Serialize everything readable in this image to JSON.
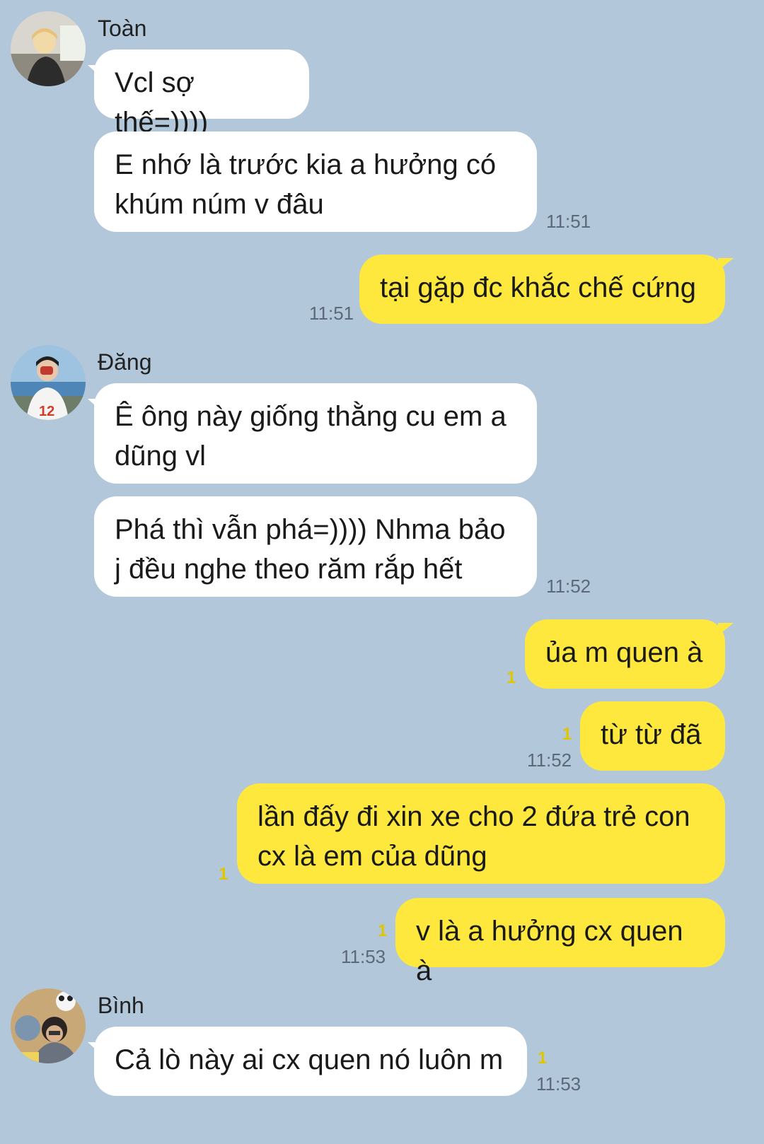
{
  "colors": {
    "background": "#b2c7da",
    "incoming_bubble": "#ffffff",
    "outgoing_bubble": "#fee83d",
    "timestamp": "#5b6978",
    "unread_count": "#e0c600"
  },
  "messages": {
    "toan": {
      "name": "Toàn",
      "avatar_icon": "user-photo-avatar",
      "m1": "Vcl sợ thế=))))",
      "m2": "E nhớ là trước kia a hưởng có khúm núm v đâu",
      "time": "11:51"
    },
    "me1": {
      "m1": "tại gặp đc khắc chế cứng",
      "time": "11:51"
    },
    "dang": {
      "name": "Đăng",
      "avatar_icon": "user-photo-avatar",
      "m1": "Ê ông này giống thằng cu em a dũng vl",
      "m2": "Phá thì vẫn phá=)))) Nhma bảo j đều nghe theo răm rắp hết",
      "time": "11:52"
    },
    "me2": {
      "m1": "ủa m quen à",
      "m1_unread": "1",
      "m2": "từ từ đã",
      "m2_unread": "1",
      "time": "11:52",
      "m3": "lần đấy đi xin xe cho 2 đứa trẻ con cx là em của dũng",
      "m3_unread": "1",
      "m4": "v là a hưởng cx quen à",
      "m4_unread": "1",
      "time2": "11:53"
    },
    "binh": {
      "name": "Bình",
      "avatar_icon": "user-photo-avatar",
      "m1": "Cả lò này ai cx quen nó luôn m",
      "m1_unread": "1",
      "time": "11:53"
    }
  }
}
